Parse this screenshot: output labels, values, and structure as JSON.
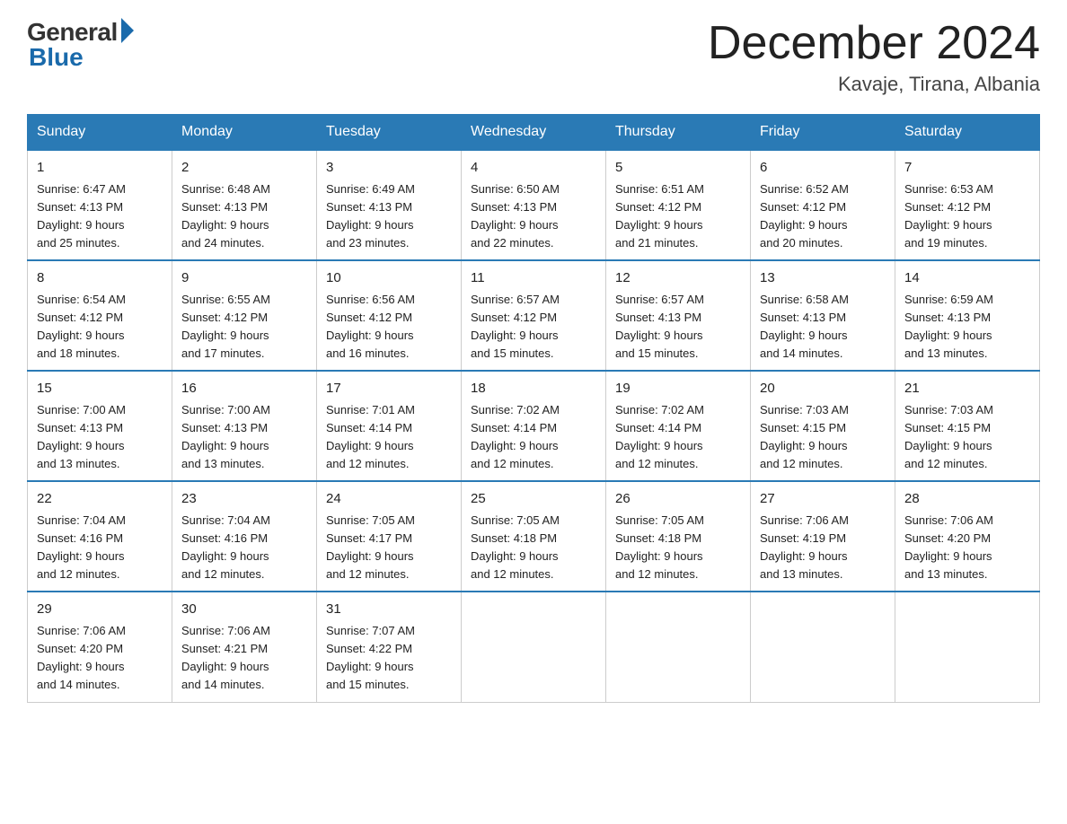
{
  "header": {
    "logo_general": "General",
    "logo_blue": "Blue",
    "month_title": "December 2024",
    "location": "Kavaje, Tirana, Albania"
  },
  "days_of_week": [
    "Sunday",
    "Monday",
    "Tuesday",
    "Wednesday",
    "Thursday",
    "Friday",
    "Saturday"
  ],
  "weeks": [
    [
      {
        "num": "1",
        "sunrise": "6:47 AM",
        "sunset": "4:13 PM",
        "daylight": "9 hours and 25 minutes."
      },
      {
        "num": "2",
        "sunrise": "6:48 AM",
        "sunset": "4:13 PM",
        "daylight": "9 hours and 24 minutes."
      },
      {
        "num": "3",
        "sunrise": "6:49 AM",
        "sunset": "4:13 PM",
        "daylight": "9 hours and 23 minutes."
      },
      {
        "num": "4",
        "sunrise": "6:50 AM",
        "sunset": "4:13 PM",
        "daylight": "9 hours and 22 minutes."
      },
      {
        "num": "5",
        "sunrise": "6:51 AM",
        "sunset": "4:12 PM",
        "daylight": "9 hours and 21 minutes."
      },
      {
        "num": "6",
        "sunrise": "6:52 AM",
        "sunset": "4:12 PM",
        "daylight": "9 hours and 20 minutes."
      },
      {
        "num": "7",
        "sunrise": "6:53 AM",
        "sunset": "4:12 PM",
        "daylight": "9 hours and 19 minutes."
      }
    ],
    [
      {
        "num": "8",
        "sunrise": "6:54 AM",
        "sunset": "4:12 PM",
        "daylight": "9 hours and 18 minutes."
      },
      {
        "num": "9",
        "sunrise": "6:55 AM",
        "sunset": "4:12 PM",
        "daylight": "9 hours and 17 minutes."
      },
      {
        "num": "10",
        "sunrise": "6:56 AM",
        "sunset": "4:12 PM",
        "daylight": "9 hours and 16 minutes."
      },
      {
        "num": "11",
        "sunrise": "6:57 AM",
        "sunset": "4:12 PM",
        "daylight": "9 hours and 15 minutes."
      },
      {
        "num": "12",
        "sunrise": "6:57 AM",
        "sunset": "4:13 PM",
        "daylight": "9 hours and 15 minutes."
      },
      {
        "num": "13",
        "sunrise": "6:58 AM",
        "sunset": "4:13 PM",
        "daylight": "9 hours and 14 minutes."
      },
      {
        "num": "14",
        "sunrise": "6:59 AM",
        "sunset": "4:13 PM",
        "daylight": "9 hours and 13 minutes."
      }
    ],
    [
      {
        "num": "15",
        "sunrise": "7:00 AM",
        "sunset": "4:13 PM",
        "daylight": "9 hours and 13 minutes."
      },
      {
        "num": "16",
        "sunrise": "7:00 AM",
        "sunset": "4:13 PM",
        "daylight": "9 hours and 13 minutes."
      },
      {
        "num": "17",
        "sunrise": "7:01 AM",
        "sunset": "4:14 PM",
        "daylight": "9 hours and 12 minutes."
      },
      {
        "num": "18",
        "sunrise": "7:02 AM",
        "sunset": "4:14 PM",
        "daylight": "9 hours and 12 minutes."
      },
      {
        "num": "19",
        "sunrise": "7:02 AM",
        "sunset": "4:14 PM",
        "daylight": "9 hours and 12 minutes."
      },
      {
        "num": "20",
        "sunrise": "7:03 AM",
        "sunset": "4:15 PM",
        "daylight": "9 hours and 12 minutes."
      },
      {
        "num": "21",
        "sunrise": "7:03 AM",
        "sunset": "4:15 PM",
        "daylight": "9 hours and 12 minutes."
      }
    ],
    [
      {
        "num": "22",
        "sunrise": "7:04 AM",
        "sunset": "4:16 PM",
        "daylight": "9 hours and 12 minutes."
      },
      {
        "num": "23",
        "sunrise": "7:04 AM",
        "sunset": "4:16 PM",
        "daylight": "9 hours and 12 minutes."
      },
      {
        "num": "24",
        "sunrise": "7:05 AM",
        "sunset": "4:17 PM",
        "daylight": "9 hours and 12 minutes."
      },
      {
        "num": "25",
        "sunrise": "7:05 AM",
        "sunset": "4:18 PM",
        "daylight": "9 hours and 12 minutes."
      },
      {
        "num": "26",
        "sunrise": "7:05 AM",
        "sunset": "4:18 PM",
        "daylight": "9 hours and 12 minutes."
      },
      {
        "num": "27",
        "sunrise": "7:06 AM",
        "sunset": "4:19 PM",
        "daylight": "9 hours and 13 minutes."
      },
      {
        "num": "28",
        "sunrise": "7:06 AM",
        "sunset": "4:20 PM",
        "daylight": "9 hours and 13 minutes."
      }
    ],
    [
      {
        "num": "29",
        "sunrise": "7:06 AM",
        "sunset": "4:20 PM",
        "daylight": "9 hours and 14 minutes."
      },
      {
        "num": "30",
        "sunrise": "7:06 AM",
        "sunset": "4:21 PM",
        "daylight": "9 hours and 14 minutes."
      },
      {
        "num": "31",
        "sunrise": "7:07 AM",
        "sunset": "4:22 PM",
        "daylight": "9 hours and 15 minutes."
      },
      null,
      null,
      null,
      null
    ]
  ],
  "labels": {
    "sunrise": "Sunrise:",
    "sunset": "Sunset:",
    "daylight": "Daylight:"
  }
}
